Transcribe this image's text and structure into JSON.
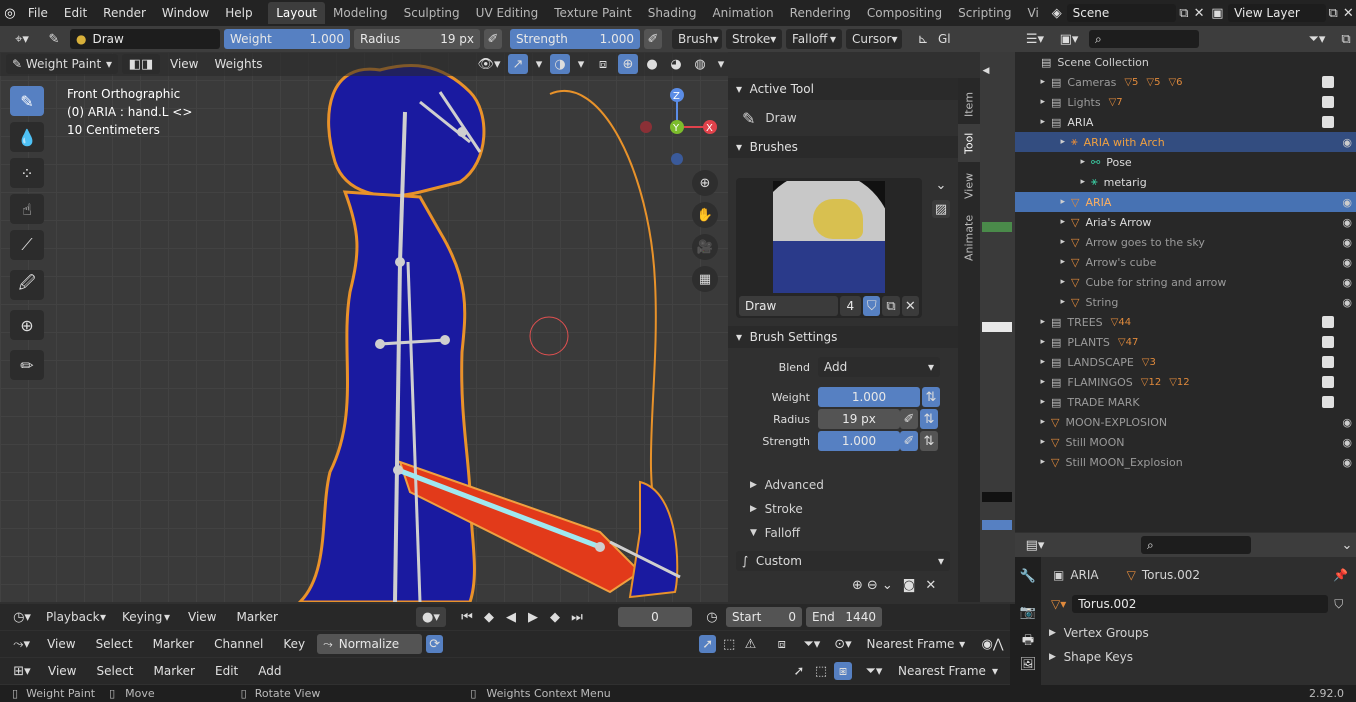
{
  "menubar": {
    "menus": [
      "File",
      "Edit",
      "Render",
      "Window",
      "Help"
    ],
    "workspaces": [
      "Layout",
      "Modeling",
      "Sculpting",
      "UV Editing",
      "Texture Paint",
      "Shading",
      "Animation",
      "Rendering",
      "Compositing",
      "Scripting",
      "Vi"
    ],
    "active_workspace": "Layout",
    "scene": "Scene",
    "view_layer": "View Layer"
  },
  "tool_header": {
    "brush_name": "Draw",
    "weight_label": "Weight",
    "weight_value": "1.000",
    "radius_label": "Radius",
    "radius_value": "19 px",
    "strength_label": "Strength",
    "strength_value": "1.000",
    "menus": [
      "Brush",
      "Stroke",
      "Falloff",
      "Cursor"
    ],
    "extra": "Gl"
  },
  "viewport_header": {
    "mode": "Weight Paint",
    "menus": [
      "View",
      "Weights"
    ]
  },
  "viewport": {
    "view_name": "Front Orthographic",
    "object_info": "(0) ARIA : hand.L <>",
    "scale_info": "10 Centimeters",
    "gizmo": {
      "z": "Z",
      "y": "Y",
      "x": "X"
    }
  },
  "npanel": {
    "tabs": [
      "Item",
      "Tool",
      "View",
      "Animate"
    ],
    "active_tool_header": "Active Tool",
    "active_tool_name": "Draw",
    "brushes_header": "Brushes",
    "brush_name": "Draw",
    "brush_users": "4",
    "brush_settings_header": "Brush Settings",
    "blend_label": "Blend",
    "blend_value": "Add",
    "weight_label": "Weight",
    "weight_value": "1.000",
    "radius_label": "Radius",
    "radius_value": "19 px",
    "strength_label": "Strength",
    "strength_value": "1.000",
    "advanced": "Advanced",
    "stroke": "Stroke",
    "falloff": "Falloff",
    "falloff_preset": "Custom"
  },
  "outliner": {
    "root": "Scene Collection",
    "rows": [
      {
        "label": "Cameras",
        "indent": 1,
        "type": "collection",
        "dim": true,
        "checked": true,
        "badges": [
          "5",
          "5",
          "6"
        ]
      },
      {
        "label": "Lights",
        "indent": 1,
        "type": "collection",
        "dim": true,
        "checked": true,
        "badges": [
          "7"
        ]
      },
      {
        "label": "ARIA",
        "indent": 1,
        "type": "collection",
        "dim": false,
        "checked": true,
        "badges": []
      },
      {
        "label": "ARIA with Arch",
        "indent": 2,
        "type": "armature",
        "dim": false,
        "selected": true,
        "eye": true,
        "badges": []
      },
      {
        "label": "Pose",
        "indent": 3,
        "type": "pose",
        "dim": false,
        "badges": []
      },
      {
        "label": "metarig",
        "indent": 3,
        "type": "armature-data",
        "dim": false,
        "badges": []
      },
      {
        "label": "ARIA",
        "indent": 2,
        "type": "mesh",
        "dim": false,
        "active": true,
        "eye": true,
        "badges": []
      },
      {
        "label": "Aria's Arrow",
        "indent": 2,
        "type": "mesh",
        "dim": false,
        "eye": true,
        "badges": []
      },
      {
        "label": "Arrow goes to the sky",
        "indent": 2,
        "type": "mesh",
        "dim": true,
        "eye": true,
        "badges": []
      },
      {
        "label": "Arrow's cube",
        "indent": 2,
        "type": "mesh",
        "dim": true,
        "eye": true,
        "badges": []
      },
      {
        "label": "Cube for string and arrow",
        "indent": 2,
        "type": "mesh",
        "dim": true,
        "eye": true,
        "badges": []
      },
      {
        "label": "String",
        "indent": 2,
        "type": "mesh",
        "dim": true,
        "eye": true,
        "badges": []
      },
      {
        "label": "TREES",
        "indent": 1,
        "type": "collection",
        "dim": true,
        "checked": true,
        "badges": [
          "44"
        ]
      },
      {
        "label": "PLANTS",
        "indent": 1,
        "type": "collection",
        "dim": true,
        "checked": true,
        "badges": [
          "47"
        ]
      },
      {
        "label": "LANDSCAPE",
        "indent": 1,
        "type": "collection",
        "dim": true,
        "checked": true,
        "badges": [
          "3"
        ]
      },
      {
        "label": "FLAMINGOS",
        "indent": 1,
        "type": "collection",
        "dim": true,
        "checked": true,
        "badges": [
          "12",
          "12"
        ]
      },
      {
        "label": "TRADE MARK",
        "indent": 1,
        "type": "collection",
        "dim": true,
        "checked": true,
        "badges": []
      },
      {
        "label": "MOON-EXPLOSION",
        "indent": 1,
        "type": "mesh",
        "dim": true,
        "eye": true,
        "badges": []
      },
      {
        "label": "Still MOON",
        "indent": 1,
        "type": "mesh",
        "dim": true,
        "eye": true,
        "badges": []
      },
      {
        "label": "Still MOON_Explosion",
        "indent": 1,
        "type": "mesh",
        "dim": true,
        "eye": true,
        "badges": []
      }
    ]
  },
  "properties": {
    "object": "ARIA",
    "data": "Torus.002",
    "mesh_name": "Torus.002",
    "sections": [
      "Vertex Groups",
      "Shape Keys"
    ]
  },
  "timeline": {
    "menus": [
      "Playback",
      "Keying",
      "View",
      "Marker"
    ],
    "current_frame": "0",
    "start_label": "Start",
    "start_value": "0",
    "end_label": "End",
    "end_value": "1440"
  },
  "graph_editor": {
    "menus": [
      "View",
      "Select",
      "Marker",
      "Channel",
      "Key"
    ],
    "normalize": "Normalize",
    "interp": "Nearest Frame"
  },
  "dopesheet": {
    "menus": [
      "View",
      "Select",
      "Marker",
      "Edit",
      "Add"
    ],
    "interp": "Nearest Frame"
  },
  "statusbar": {
    "mode": "Weight Paint",
    "move": "Move",
    "rotate": "Rotate View",
    "context": "Weights Context Menu",
    "version": "2.92.0"
  },
  "colors": {
    "accent": "#5680c2",
    "mesh_blue": "#1a1aa0",
    "wire_orange": "#e8922a",
    "weight_red": "#e23a1a",
    "selected_orange": "#f0a040"
  }
}
